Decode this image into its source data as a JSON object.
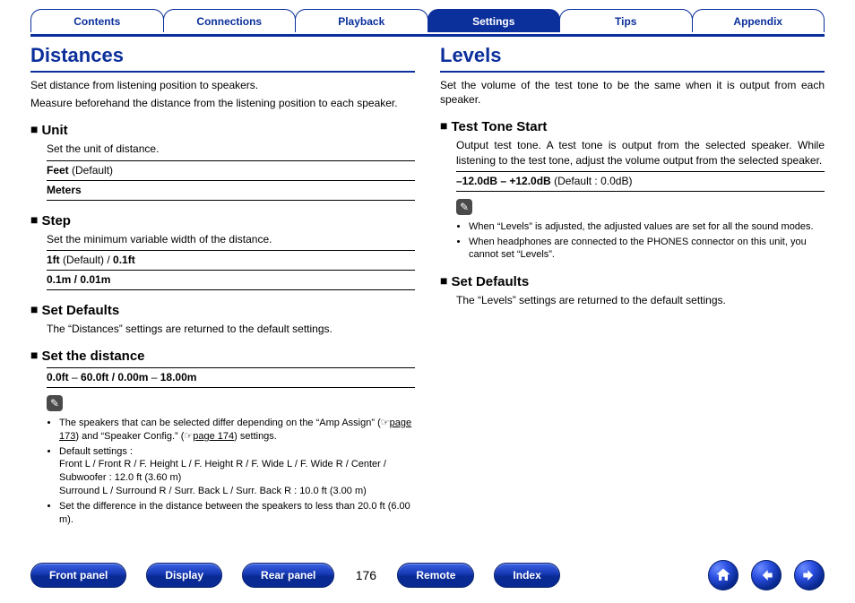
{
  "tabs": {
    "items": [
      {
        "label": "Contents",
        "active": false
      },
      {
        "label": "Connections",
        "active": false
      },
      {
        "label": "Playback",
        "active": false
      },
      {
        "label": "Settings",
        "active": true
      },
      {
        "label": "Tips",
        "active": false
      },
      {
        "label": "Appendix",
        "active": false
      }
    ]
  },
  "left": {
    "title": "Distances",
    "intro1": "Set distance from listening position to speakers.",
    "intro2": "Measure beforehand the distance from the listening position to each speaker.",
    "unit": {
      "h": "Unit",
      "desc": "Set the unit of distance.",
      "opt1_b": "Feet",
      "opt1_def": " (Default)",
      "opt2_b": "Meters"
    },
    "step": {
      "h": "Step",
      "desc": "Set the minimum variable width of the distance.",
      "opt1_b": "1ft",
      "opt1_def": " (Default) / ",
      "opt1_b2": "0.1ft",
      "opt2_b": "0.1m / 0.01m"
    },
    "setdef": {
      "h": "Set Defaults",
      "desc": "The “Distances” settings are returned to the default settings."
    },
    "setdist": {
      "h": "Set the distance",
      "range_a": "0.0ft",
      "range_dash1": " – ",
      "range_b": "60.0ft / 0.00m",
      "range_dash2": " – ",
      "range_c": "18.00m"
    },
    "notes": {
      "n1_pre": "The speakers that can be selected differ depending on the “Amp Assign” (☞",
      "n1_link1": "page 173",
      "n1_mid": ") and “Speaker Config.” (☞",
      "n1_link2": "page 174",
      "n1_post": ") settings.",
      "n2_a": "Default settings :",
      "n2_b": "Front L / Front R / F. Height L / F. Height R / F. Wide L / F. Wide R / Center / Subwoofer : 12.0 ft (3.60 m)",
      "n2_c": "Surround L / Surround R / Surr. Back L / Surr. Back R : 10.0 ft (3.00 m)",
      "n3": "Set the difference in the distance between the speakers to less than 20.0 ft (6.00 m)."
    }
  },
  "right": {
    "title": "Levels",
    "intro": "Set the volume of the test tone to be the same when it is output from each speaker.",
    "tts": {
      "h": "Test Tone Start",
      "desc": "Output test tone. A test tone is output from the selected speaker. While listening to the test tone, adjust the volume output from the selected speaker.",
      "range_b": "–12.0dB – +12.0dB",
      "range_def": " (Default : 0.0dB)"
    },
    "notes": {
      "n1": "When “Levels” is adjusted, the adjusted values are set for all the sound modes.",
      "n2": "When headphones are connected to the PHONES connector on this unit, you cannot set “Levels”."
    },
    "setdef": {
      "h": "Set Defaults",
      "desc": "The “Levels” settings are returned to the default settings."
    }
  },
  "footer": {
    "pills_left": [
      "Front panel",
      "Display",
      "Rear panel"
    ],
    "page": "176",
    "pills_right": [
      "Remote",
      "Index"
    ]
  },
  "pencil_glyph": "✎"
}
